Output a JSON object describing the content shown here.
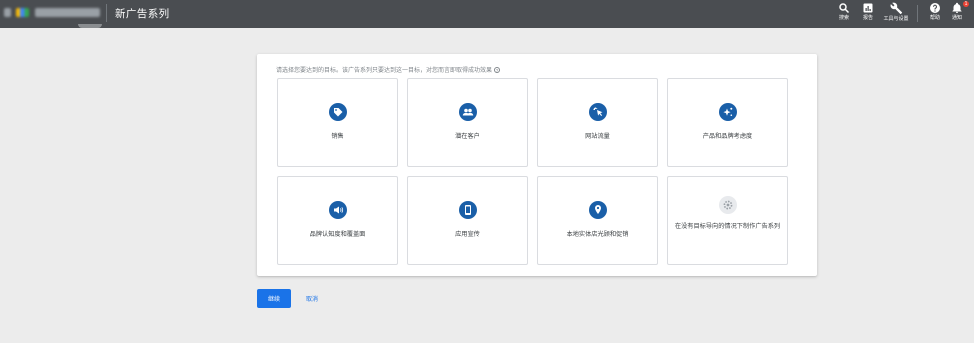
{
  "header": {
    "title": "新广告系列",
    "tools": [
      {
        "label": "搜索",
        "icon": "search-icon"
      },
      {
        "label": "报告",
        "icon": "reports-icon"
      },
      {
        "label": "工具与设置",
        "icon": "wrench-icon"
      },
      {
        "label": "帮助",
        "icon": "help-icon"
      },
      {
        "label": "通知",
        "icon": "bell-icon",
        "badge": "1"
      }
    ]
  },
  "goal": {
    "prompt": "请选择您要达到的目标。该广告系列只要达到这一目标，对您而言即取得成功效果",
    "help_glyph": "?",
    "options": [
      {
        "label": "销售",
        "icon": "tag-icon"
      },
      {
        "label": "潜在客户",
        "icon": "people-icon"
      },
      {
        "label": "网站流量",
        "icon": "cursor-click-icon"
      },
      {
        "label": "产品和品牌考虑度",
        "icon": "sparkle-icon"
      },
      {
        "label": "品牌认知度和覆盖面",
        "icon": "megaphone-icon"
      },
      {
        "label": "应用宣传",
        "icon": "phone-icon"
      },
      {
        "label": "本地实体店光顾和促销",
        "icon": "location-pin-icon"
      },
      {
        "label": "在没有目标导向的情况下制作广告系列",
        "icon": "gear-icon"
      }
    ]
  },
  "actions": {
    "continue_label": "继续",
    "cancel_label": "取消"
  },
  "colors": {
    "topbar": "#4a4d51",
    "icon_blue": "#1a5fa8",
    "primary": "#1a73e8",
    "background": "#ececec"
  }
}
